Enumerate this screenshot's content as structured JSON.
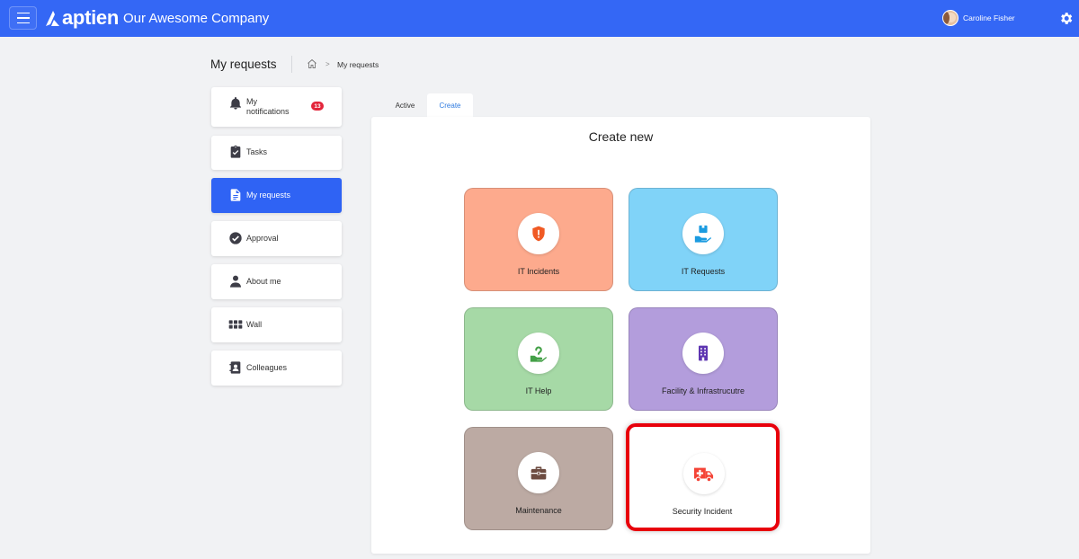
{
  "topbar": {
    "logo_text": "aptien",
    "company": "Our Awesome Company",
    "user_name": "Caroline Fisher"
  },
  "header": {
    "title": "My requests",
    "breadcrumb_current": "My requests",
    "breadcrumb_separator": ">"
  },
  "sidebar": {
    "items": [
      {
        "label": "My notifications",
        "icon": "bell-icon",
        "badge": "13"
      },
      {
        "label": "Tasks",
        "icon": "clipboard-check-icon"
      },
      {
        "label": "My requests",
        "icon": "document-icon",
        "active": true
      },
      {
        "label": "Approval",
        "icon": "check-circle-icon"
      },
      {
        "label": "About me",
        "icon": "person-icon"
      },
      {
        "label": "Wall",
        "icon": "grid-icon"
      },
      {
        "label": "Colleagues",
        "icon": "contact-book-icon"
      }
    ]
  },
  "tabs": [
    {
      "label": "Active",
      "selected": false
    },
    {
      "label": "Create",
      "selected": true
    }
  ],
  "main": {
    "title": "Create new",
    "cards": [
      {
        "label": "IT Incidents",
        "color": "#fdaa8d",
        "icon": "shield-alert-icon",
        "icon_color": "#f05a24"
      },
      {
        "label": "IT Requests",
        "color": "#80d3f8",
        "icon": "hand-box-icon",
        "icon_color": "#1b9be0"
      },
      {
        "label": "IT Help",
        "color": "#a6d9a6",
        "icon": "hand-help-icon",
        "icon_color": "#43a047"
      },
      {
        "label": "Facility & Infrastrucutre",
        "color": "#b39ddc",
        "icon": "building-icon",
        "icon_color": "#5e35b1"
      },
      {
        "label": "Maintenance",
        "color": "#bcaaa3",
        "icon": "briefcase-icon",
        "icon_color": "#6d4c41"
      },
      {
        "label": "Security Incident",
        "color": "#ffffff",
        "icon": "ambulance-icon",
        "icon_color": "#f44336",
        "highlighted": true
      }
    ]
  },
  "colors": {
    "topbar": "#3467f5",
    "active_nav": "#2f63f4",
    "badge": "#e3263b",
    "highlight": "#e8000b"
  }
}
